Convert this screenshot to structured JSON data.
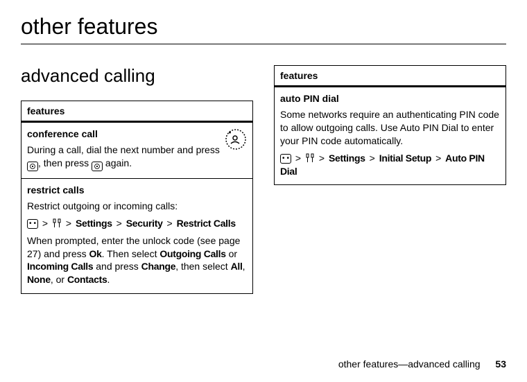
{
  "page_title": "other features",
  "section_heading": "advanced calling",
  "left_table": {
    "header": "features",
    "rows": [
      {
        "name": "conference call",
        "desc_pre": "During a call, dial the next number and press ",
        "desc_mid": ", then press ",
        "desc_post": " again."
      },
      {
        "name": "restrict calls",
        "intro": "Restrict outgoing or incoming calls:",
        "nav1": "Settings",
        "nav2": "Security",
        "nav3": "Restrict Calls",
        "follow_pre": "When prompted, enter the unlock code (see page 27) and press ",
        "ok": "Ok",
        "follow_mid1": ". Then select ",
        "outgoing": "Outgoing Calls",
        "or1": " or ",
        "incoming": "Incoming Calls",
        "follow_mid2": " and press ",
        "change": "Change",
        "follow_mid3": ", then select ",
        "all": "All",
        "comma1": ", ",
        "none": "None",
        "comma2": ", or ",
        "contacts": "Contacts",
        "period": "."
      }
    ]
  },
  "right_table": {
    "header": "features",
    "rows": [
      {
        "name": "auto PIN dial",
        "desc": "Some networks require an authenticating PIN code to allow outgoing calls. Use Auto PIN Dial to enter your PIN code automatically.",
        "nav1": "Settings",
        "nav2": "Initial Setup",
        "nav3": "Auto PIN Dial"
      }
    ]
  },
  "footer": {
    "text": "other features—advanced calling",
    "page": "53"
  }
}
